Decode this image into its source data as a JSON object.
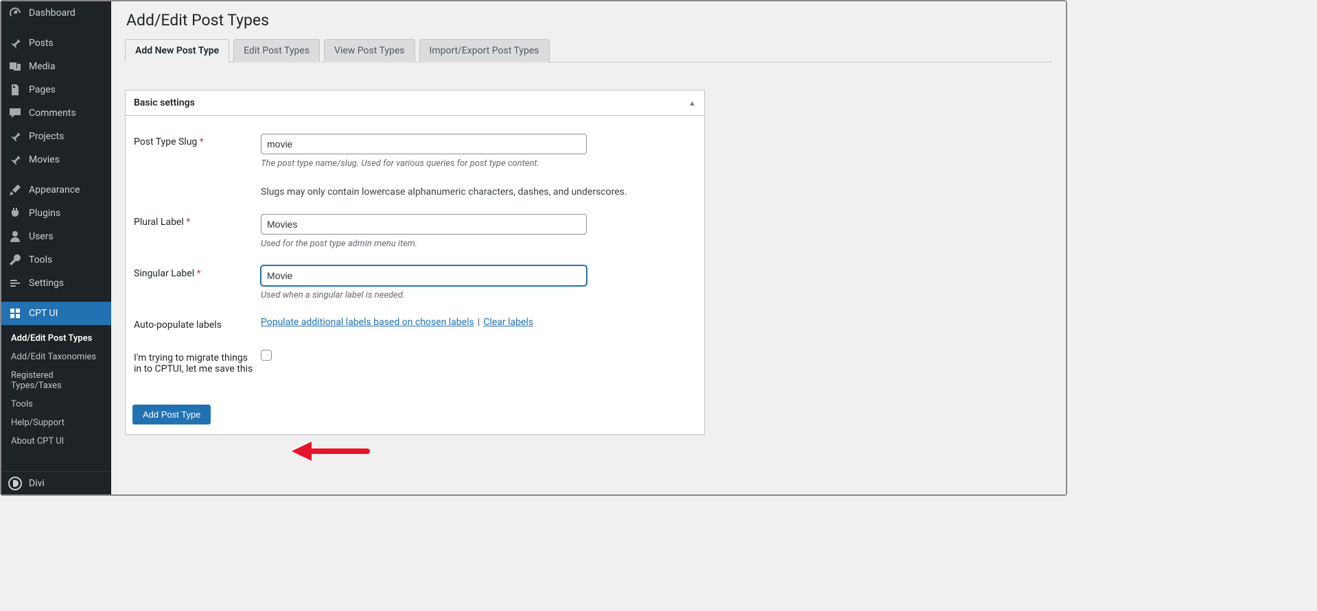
{
  "sidebar": {
    "items": [
      {
        "label": "Dashboard"
      },
      {
        "label": "Posts"
      },
      {
        "label": "Media"
      },
      {
        "label": "Pages"
      },
      {
        "label": "Comments"
      },
      {
        "label": "Projects"
      },
      {
        "label": "Movies"
      },
      {
        "label": "Appearance"
      },
      {
        "label": "Plugins"
      },
      {
        "label": "Users"
      },
      {
        "label": "Tools"
      },
      {
        "label": "Settings"
      },
      {
        "label": "CPT UI"
      }
    ],
    "submenu": [
      {
        "label": "Add/Edit Post Types",
        "current": true
      },
      {
        "label": "Add/Edit Taxonomies"
      },
      {
        "label": "Registered Types/Taxes"
      },
      {
        "label": "Tools"
      },
      {
        "label": "Help/Support"
      },
      {
        "label": "About CPT UI"
      }
    ],
    "bottom": {
      "label": "Divi"
    }
  },
  "page": {
    "title": "Add/Edit Post Types"
  },
  "tabs": [
    {
      "label": "Add New Post Type",
      "active": true
    },
    {
      "label": "Edit Post Types"
    },
    {
      "label": "View Post Types"
    },
    {
      "label": "Import/Export Post Types"
    }
  ],
  "panel": {
    "title": "Basic settings"
  },
  "form": {
    "slug": {
      "label": "Post Type Slug",
      "value": "movie",
      "help1": "The post type name/slug. Used for various queries for post type content.",
      "help2": "Slugs may only contain lowercase alphanumeric characters, dashes, and underscores."
    },
    "plural": {
      "label": "Plural Label",
      "value": "Movies",
      "help": "Used for the post type admin menu item."
    },
    "singular": {
      "label": "Singular Label",
      "value": "Movie",
      "help": "Used when a singular label is needed."
    },
    "autopop": {
      "label": "Auto-populate labels",
      "link1": "Populate additional labels based on chosen labels",
      "sep": " | ",
      "link2": "Clear labels"
    },
    "migrate": {
      "label": "I'm trying to migrate things in to CPTUI, let me save this"
    },
    "submit": {
      "label": "Add Post Type"
    }
  }
}
